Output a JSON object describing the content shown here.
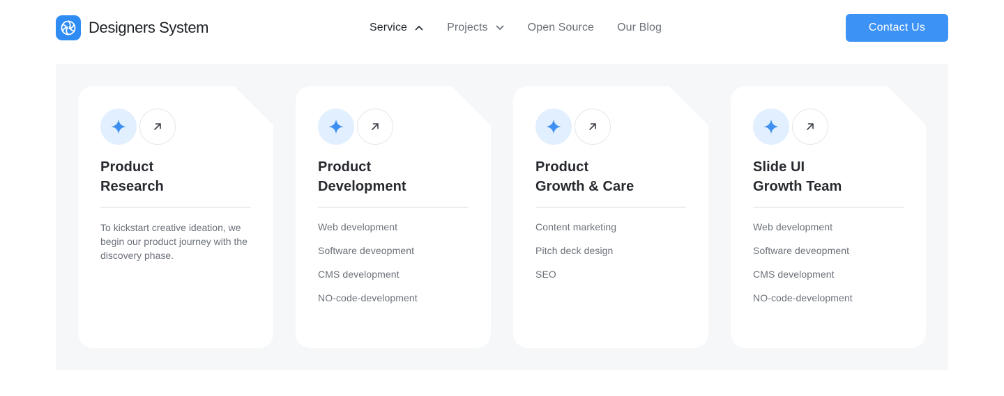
{
  "header": {
    "brand_name": "Designers System",
    "logo_icon": "aperture-logo-icon",
    "nav": [
      {
        "label": "Service",
        "icon": "chevron-up-icon",
        "active": true
      },
      {
        "label": "Projects",
        "icon": "chevron-down-icon",
        "active": false
      },
      {
        "label": "Open Source"
      },
      {
        "label": "Our Blog"
      }
    ],
    "cta_label": "Contact Us"
  },
  "colors": {
    "accent": "#3d92f5",
    "panel_bg": "#f6f7f9",
    "icon_bg": "#e1efff",
    "text_muted": "#6b7079"
  },
  "cards": [
    {
      "title_line1": "Product",
      "title_line2": "Research",
      "description": "To kickstart creative ideation, we begin our product journey with the discovery phase."
    },
    {
      "title_line1": "Product",
      "title_line2": "Development",
      "items": [
        "Web development",
        "Software deveopment",
        "CMS development",
        "NO-code-development"
      ]
    },
    {
      "title_line1": "Product",
      "title_line2": "Growth & Care",
      "items": [
        "Content marketing",
        "Pitch deck design",
        "SEO"
      ]
    },
    {
      "title_line1": "Slide UI",
      "title_line2": "Growth Team",
      "items": [
        "Web development",
        "Software deveopment",
        "CMS development",
        "NO-code-development"
      ]
    }
  ]
}
